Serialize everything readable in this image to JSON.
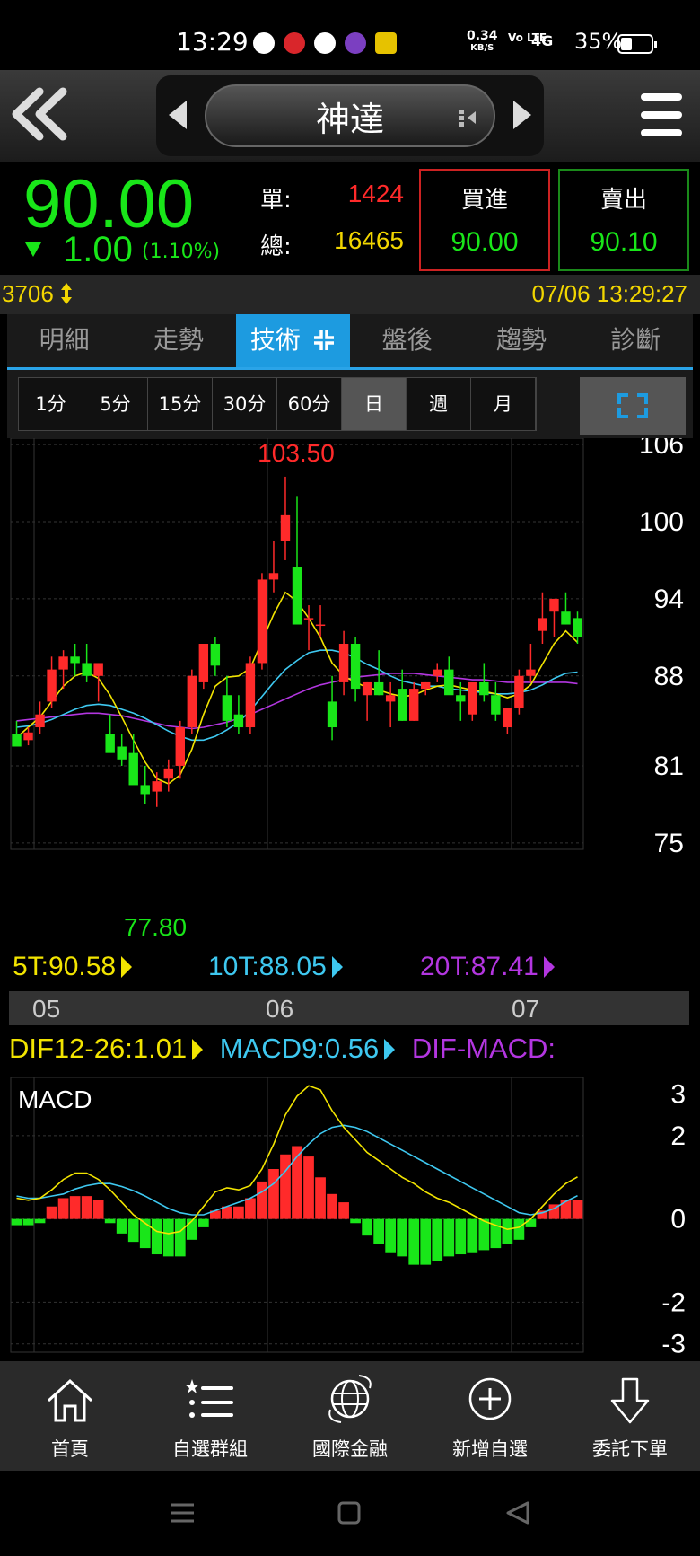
{
  "status": {
    "time": "13:29",
    "speed_value": "0.34",
    "speed_unit": "KB/S",
    "volte": "Vo LTE",
    "network": "4G",
    "battery": "35%"
  },
  "header": {
    "stock_name": "神達"
  },
  "quote": {
    "price": "90.00",
    "change": "1.00",
    "change_pct": "(1.10%)",
    "single_label": "單:",
    "single_value": "1424",
    "total_label": "總:",
    "total_value": "16465",
    "buy_label": "買進",
    "buy_price": "90.00",
    "sell_label": "賣出",
    "sell_price": "90.10",
    "colors": {
      "down": "#19e619",
      "up": "#ff2a2a",
      "yellow": "#f2d600"
    }
  },
  "info": {
    "volume": "3706",
    "datetime": "07/06 13:29:27"
  },
  "tabs": [
    "明細",
    "走勢",
    "技術",
    "盤後",
    "趨勢",
    "診斷"
  ],
  "active_tab": 2,
  "periods": [
    "1分",
    "5分",
    "15分",
    "30分",
    "60分",
    "日",
    "週",
    "月"
  ],
  "active_period": 5,
  "ma": {
    "ma5": "5T:90.58",
    "ma10": "10T:88.05",
    "ma20": "20T:87.41"
  },
  "months": [
    "05",
    "06",
    "07"
  ],
  "macd_legend": {
    "dif": "DIF12-26:1.01",
    "macd": "MACD9:0.56",
    "osc": "DIF-MACD:"
  },
  "macd_title": "MACD",
  "nav": [
    "首頁",
    "自選群組",
    "國際金融",
    "新增自選",
    "委託下單"
  ],
  "chart_data": [
    {
      "type": "candlestick",
      "title": "",
      "y_ticks": [
        106,
        100,
        94,
        88,
        81,
        75
      ],
      "ylim": [
        74.5,
        106.5
      ],
      "annotations": {
        "high": "103.50",
        "low": "77.80"
      },
      "ohlc": [
        [
          83.5,
          84.5,
          82.5,
          82.5
        ],
        [
          83.0,
          84.0,
          82.6,
          83.6
        ],
        [
          84.0,
          86.0,
          83.5,
          85.0
        ],
        [
          86.0,
          89.5,
          85.5,
          88.5
        ],
        [
          88.5,
          90.0,
          87.0,
          89.5
        ],
        [
          89.5,
          90.5,
          88.0,
          89.0
        ],
        [
          89.0,
          90.5,
          87.5,
          88.0
        ],
        [
          88.0,
          89.0,
          86.0,
          89.0
        ],
        [
          83.5,
          85.0,
          82.5,
          82.0
        ],
        [
          82.5,
          83.5,
          81.0,
          81.5
        ],
        [
          82.0,
          83.5,
          80.0,
          79.5
        ],
        [
          79.5,
          81.0,
          78.0,
          78.8
        ],
        [
          79.0,
          80.5,
          77.8,
          79.8
        ],
        [
          80.0,
          81.5,
          79.0,
          80.8
        ],
        [
          81.0,
          84.5,
          80.0,
          84.0
        ],
        [
          84.0,
          88.5,
          83.5,
          88.0
        ],
        [
          87.5,
          90.5,
          87.0,
          90.5
        ],
        [
          90.5,
          91.0,
          88.0,
          88.8
        ],
        [
          86.5,
          88.0,
          84.0,
          84.5
        ],
        [
          85.0,
          86.5,
          83.5,
          84.0
        ],
        [
          84.0,
          89.5,
          83.5,
          89.0
        ],
        [
          89.0,
          96.0,
          88.5,
          95.5
        ],
        [
          95.5,
          98.5,
          94.5,
          96.0
        ],
        [
          98.5,
          103.5,
          97.0,
          100.5
        ],
        [
          96.5,
          102.0,
          92.0,
          92.0
        ],
        [
          92.5,
          93.5,
          90.0,
          92.5
        ],
        [
          92.0,
          93.5,
          91.0,
          92.0
        ],
        [
          86.0,
          88.0,
          83.0,
          84.0
        ],
        [
          87.5,
          91.5,
          86.5,
          90.5
        ],
        [
          90.5,
          91.0,
          86.0,
          87.0
        ],
        [
          86.5,
          87.5,
          84.5,
          87.5
        ],
        [
          87.5,
          90.0,
          86.5,
          86.5
        ],
        [
          86.0,
          87.5,
          84.0,
          86.5
        ],
        [
          87.0,
          88.5,
          84.5,
          84.5
        ],
        [
          84.5,
          87.5,
          84.5,
          87.0
        ],
        [
          87.0,
          87.5,
          86.5,
          87.5
        ],
        [
          88.0,
          89.0,
          87.5,
          88.5
        ],
        [
          88.5,
          89.5,
          87.0,
          86.5
        ],
        [
          86.5,
          87.5,
          84.5,
          86.0
        ],
        [
          85.0,
          86.0,
          84.5,
          87.5
        ],
        [
          87.5,
          89.0,
          86.0,
          86.5
        ],
        [
          86.5,
          87.5,
          84.5,
          85.0
        ],
        [
          84.0,
          85.5,
          83.5,
          85.5
        ],
        [
          85.5,
          88.5,
          85.0,
          88.0
        ],
        [
          88.0,
          90.5,
          87.5,
          88.5
        ],
        [
          91.5,
          94.5,
          90.5,
          92.5
        ],
        [
          93.0,
          94.0,
          91.0,
          94.0
        ],
        [
          93.0,
          94.5,
          92.0,
          92.0
        ],
        [
          92.5,
          93.0,
          90.5,
          91.0
        ]
      ],
      "ma5": [
        83.2,
        84.0,
        84.8,
        86.0,
        87.2,
        88.0,
        88.3,
        87.8,
        86.5,
        84.8,
        83.0,
        81.3,
        80.0,
        79.6,
        80.3,
        82.3,
        85.0,
        87.2,
        87.9,
        88.0,
        88.6,
        90.7,
        92.8,
        94.5,
        93.8,
        92.5,
        91.0,
        89.0,
        88.0,
        87.5,
        87.1,
        86.9,
        86.6,
        86.4,
        86.5,
        86.9,
        87.2,
        87.3,
        87.1,
        86.9,
        86.8,
        86.6,
        86.3,
        86.6,
        87.3,
        88.9,
        90.5,
        91.5,
        90.6
      ],
      "ma10": [
        84.0,
        84.1,
        84.3,
        84.6,
        85.0,
        85.4,
        85.7,
        85.8,
        85.7,
        85.4,
        85.1,
        84.7,
        84.2,
        83.7,
        83.3,
        83.0,
        83.0,
        83.3,
        83.8,
        84.4,
        85.3,
        86.4,
        87.5,
        88.5,
        89.2,
        89.8,
        90.0,
        90.0,
        89.8,
        89.4,
        88.9,
        88.5,
        88.0,
        87.6,
        87.4,
        87.2,
        87.2,
        87.0,
        86.9,
        86.8,
        86.7,
        86.6,
        86.6,
        86.7,
        86.9,
        87.3,
        87.8,
        88.2,
        88.3
      ],
      "ma20": [
        84.5,
        84.6,
        84.7,
        84.8,
        84.9,
        85.0,
        85.1,
        85.1,
        85.0,
        84.9,
        84.7,
        84.5,
        84.3,
        84.1,
        84.0,
        83.9,
        84.0,
        84.2,
        84.4,
        84.7,
        85.0,
        85.4,
        85.8,
        86.2,
        86.6,
        87.0,
        87.3,
        87.5,
        87.7,
        87.9,
        88.0,
        88.1,
        88.2,
        88.2,
        88.2,
        88.1,
        88.0,
        87.9,
        87.8,
        87.7,
        87.7,
        87.6,
        87.5,
        87.5,
        87.5,
        87.5,
        87.5,
        87.5,
        87.4
      ]
    },
    {
      "type": "macd",
      "y_ticks": [
        3,
        2,
        0,
        -2,
        -3
      ],
      "ylim": [
        -3.2,
        3.4
      ],
      "dif": [
        0.5,
        0.45,
        0.5,
        0.7,
        0.95,
        1.1,
        1.1,
        0.95,
        0.7,
        0.4,
        0.1,
        -0.1,
        -0.3,
        -0.35,
        -0.3,
        -0.05,
        0.3,
        0.65,
        0.75,
        0.7,
        0.8,
        1.2,
        1.8,
        2.5,
        2.95,
        3.2,
        3.1,
        2.6,
        2.2,
        1.9,
        1.6,
        1.4,
        1.2,
        1.0,
        0.85,
        0.65,
        0.5,
        0.4,
        0.25,
        0.1,
        -0.05,
        -0.15,
        -0.25,
        -0.2,
        0.0,
        0.3,
        0.6,
        0.85,
        1.01
      ],
      "macd": [
        0.55,
        0.5,
        0.5,
        0.55,
        0.6,
        0.72,
        0.8,
        0.85,
        0.85,
        0.78,
        0.68,
        0.55,
        0.4,
        0.25,
        0.15,
        0.1,
        0.1,
        0.2,
        0.3,
        0.4,
        0.5,
        0.65,
        0.85,
        1.15,
        1.5,
        1.8,
        2.05,
        2.2,
        2.25,
        2.2,
        2.1,
        1.95,
        1.8,
        1.65,
        1.5,
        1.35,
        1.2,
        1.05,
        0.9,
        0.75,
        0.6,
        0.45,
        0.3,
        0.15,
        0.1,
        0.15,
        0.25,
        0.42,
        0.56
      ],
      "osc": [
        -0.15,
        -0.15,
        -0.1,
        0.3,
        0.5,
        0.55,
        0.55,
        0.45,
        -0.1,
        -0.35,
        -0.55,
        -0.7,
        -0.85,
        -0.9,
        -0.9,
        -0.5,
        -0.2,
        0.2,
        0.3,
        0.3,
        0.5,
        0.9,
        1.2,
        1.55,
        1.75,
        1.5,
        1.0,
        0.6,
        0.4,
        -0.1,
        -0.4,
        -0.6,
        -0.8,
        -0.9,
        -1.1,
        -1.1,
        -1.0,
        -0.9,
        -0.85,
        -0.8,
        -0.75,
        -0.7,
        -0.6,
        -0.5,
        -0.2,
        0.2,
        0.35,
        0.45,
        0.45
      ]
    }
  ]
}
